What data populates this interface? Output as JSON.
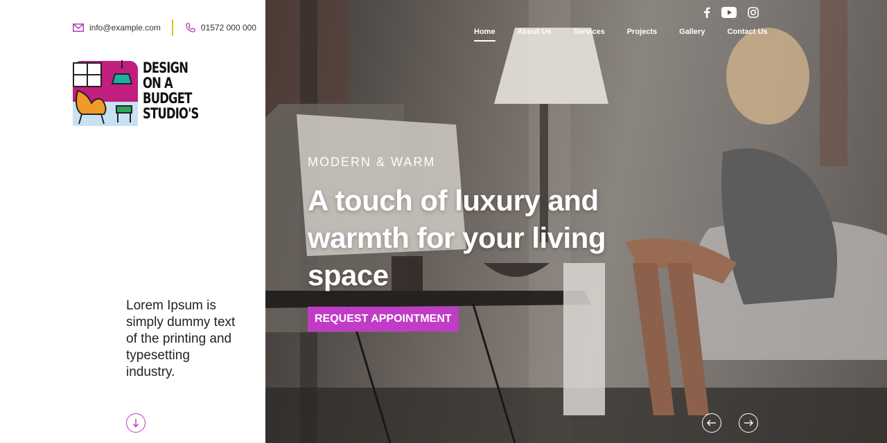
{
  "contact": {
    "email": "info@example.com",
    "phone": "01572 000 000"
  },
  "logo": {
    "line1": "DESIGN",
    "line2": "ON A",
    "line3": "BUDGET",
    "line4": "STUDIO'S"
  },
  "tagline": "Lorem Ipsum is simply dummy text of the printing and typesetting industry.",
  "nav": {
    "items": [
      {
        "label": "Home",
        "active": true
      },
      {
        "label": "About Us"
      },
      {
        "label": "Services"
      },
      {
        "label": "Projects"
      },
      {
        "label": "Gallery"
      },
      {
        "label": "Contact Us"
      }
    ]
  },
  "social": {
    "icons": [
      "facebook-icon",
      "youtube-icon",
      "instagram-icon"
    ]
  },
  "hero": {
    "eyebrow": "MODERN & WARM",
    "headline": "A touch of luxury and warmth for your living space",
    "cta": "REQUEST APPOINTMENT"
  },
  "controls": {
    "prev_icon": "arrow-left-icon",
    "next_icon": "arrow-right-icon",
    "scroll_icon": "arrow-down-icon"
  },
  "colors": {
    "accent": "#c13cc6",
    "divider": "#e9c21f",
    "text": "#222222"
  }
}
